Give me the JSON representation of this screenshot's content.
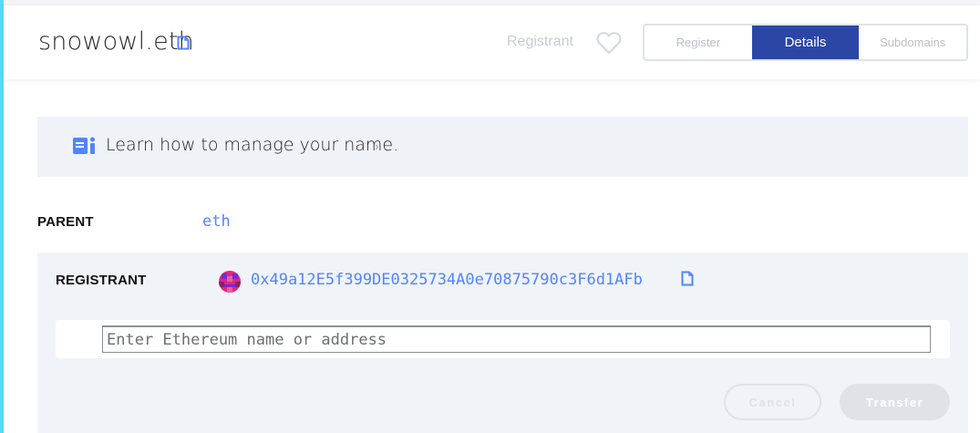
{
  "header": {
    "domain_name": "snowowl.eth",
    "registrant_label": "Registrant",
    "tabs": [
      {
        "label": "Register",
        "active": false
      },
      {
        "label": "Details",
        "active": true
      },
      {
        "label": "Subdomains",
        "active": false
      }
    ]
  },
  "info_banner": {
    "text": "Learn how to manage your name.",
    "chevron": "›"
  },
  "details": {
    "parent_label": "PARENT",
    "parent_value": "eth",
    "registrant_label": "REGISTRANT",
    "registrant_address": "0x49a12E5f399DE0325734A0e70875790c3F6d1AFb",
    "input_placeholder": "Enter Ethereum name or address",
    "input_value": "",
    "cancel_label": "Cancel",
    "transfer_label": "Transfer"
  },
  "icons": {
    "title_copy": "copy-icon",
    "favorite": "heart-icon",
    "banner": "book-icon",
    "address_copy": "copy-icon",
    "avatar": "blockie-avatar"
  },
  "colors": {
    "accent": "#2c46a6",
    "link": "#5284ff",
    "sidebar_accent": "#5ad7f6",
    "panel_bg": "#f0f3f7",
    "disabled": "#dfe3e8"
  }
}
